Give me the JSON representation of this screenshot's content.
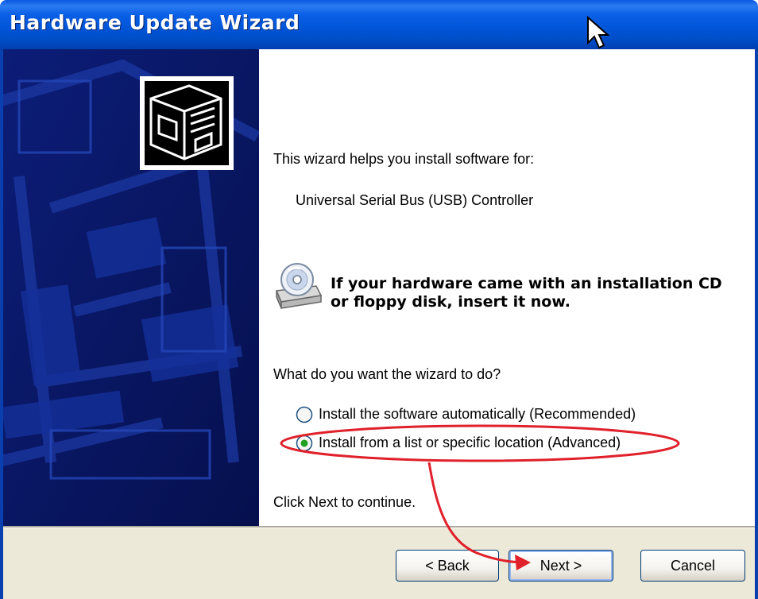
{
  "window": {
    "title": "Hardware Update Wizard"
  },
  "intro": {
    "line1": "This wizard helps you install software for:",
    "device": "Universal Serial Bus (USB) Controller"
  },
  "cd_notice": {
    "line1": "If your hardware came with an installation CD",
    "line2": "or floppy disk, insert it now."
  },
  "question": "What do you want the wizard to do?",
  "options": [
    {
      "label": "Install the software automatically (Recommended)",
      "selected": false
    },
    {
      "label": "Install from a list or specific location (Advanced)",
      "selected": true
    }
  ],
  "footer_hint": "Click Next to continue.",
  "buttons": {
    "back": "< Back",
    "next": "Next >",
    "cancel": "Cancel"
  },
  "icons": {
    "hardware": "hardware-card-icon",
    "cd": "cd-drive-icon",
    "cursor": "mouse-cursor-icon"
  },
  "colors": {
    "title_bar": "#0054d6",
    "side_panel": "#0a1a6b",
    "annotation": "#e0202a",
    "radio_dot": "#21a121"
  }
}
